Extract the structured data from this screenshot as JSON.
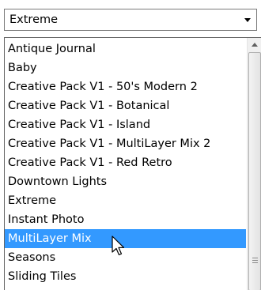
{
  "combo": {
    "value": "Extreme",
    "arrow_icon": "chevron-down-icon"
  },
  "dropdown": {
    "items": [
      "Antique Journal",
      "Baby",
      "Creative Pack V1 - 50's Modern 2",
      "Creative Pack V1 - Botanical",
      "Creative Pack V1 - Island",
      "Creative Pack V1 - MultiLayer Mix 2",
      "Creative Pack V1 - Red Retro",
      "Downtown Lights",
      "Extreme",
      "Instant Photo",
      "MultiLayer Mix",
      "Seasons",
      "Sliding Tiles"
    ],
    "selected_index": 10
  },
  "colors": {
    "selection": "#3399ff",
    "selection_text": "#ffffff"
  }
}
